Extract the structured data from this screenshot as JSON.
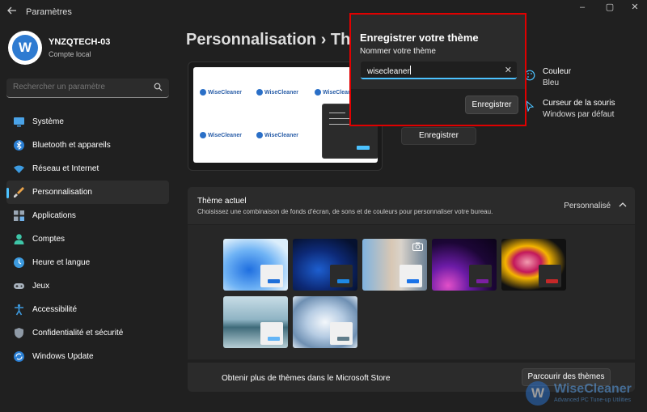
{
  "window": {
    "title": "Paramètres",
    "minimize": "–",
    "maximize": "▢",
    "close": "✕"
  },
  "user": {
    "avatar_letter": "W",
    "name": "YNZQTECH-03",
    "account": "Compte local"
  },
  "search": {
    "placeholder": "Rechercher un paramètre"
  },
  "sidebar": {
    "items": [
      {
        "label": "Système",
        "icon": "monitor-icon"
      },
      {
        "label": "Bluetooth et appareils",
        "icon": "bluetooth-icon"
      },
      {
        "label": "Réseau et Internet",
        "icon": "wifi-icon"
      },
      {
        "label": "Personnalisation",
        "icon": "brush-icon",
        "active": true
      },
      {
        "label": "Applications",
        "icon": "apps-icon"
      },
      {
        "label": "Comptes",
        "icon": "person-icon"
      },
      {
        "label": "Heure et langue",
        "icon": "clock-globe-icon"
      },
      {
        "label": "Jeux",
        "icon": "gamepad-icon"
      },
      {
        "label": "Accessibilité",
        "icon": "accessibility-icon"
      },
      {
        "label": "Confidentialité et sécurité",
        "icon": "shield-icon"
      },
      {
        "label": "Windows Update",
        "icon": "update-icon"
      }
    ]
  },
  "header": {
    "breadcrumb": "Personnalisation  ›  Th"
  },
  "preview": {
    "logo_text": "WiseCleaner"
  },
  "properties": {
    "color_label": "Couleur",
    "color_value": "Bleu",
    "cursor_label": "Curseur de la souris",
    "cursor_value": "Windows par défaut"
  },
  "save_button": "Enregistrer",
  "dialog": {
    "title": "Enregistrer votre thème",
    "field_label": "Nommer votre thème",
    "field_value": "wisecleaner",
    "clear": "✕",
    "save": "Enregistrer"
  },
  "current_theme": {
    "title": "Thème actuel",
    "description": "Choisissez une combinaison de fonds d'écran, de sons et de couleurs pour personnaliser votre bureau.",
    "value": "Personnalisé"
  },
  "themes": [
    {
      "name": "windows-light-bloom",
      "accent": "#1e6fd9"
    },
    {
      "name": "windows-dark-bloom",
      "accent": "#1e88e5"
    },
    {
      "name": "captured-motion",
      "accent": "#1a73e8"
    },
    {
      "name": "glow",
      "accent": "#7b1fa2"
    },
    {
      "name": "flower",
      "accent": "#c62828"
    },
    {
      "name": "sunrise-lake",
      "accent": "#64b5f6"
    },
    {
      "name": "flow",
      "accent": "#607d8b"
    }
  ],
  "store": {
    "text": "Obtenir plus de thèmes dans le Microsoft Store",
    "button": "Parcourir des thèmes"
  },
  "watermark": {
    "name": "WiseCleaner",
    "tagline": "Advanced PC Tune-up Utilities"
  },
  "colors": {
    "accent": "#4cc2ff",
    "highlight_border": "#e00000"
  }
}
